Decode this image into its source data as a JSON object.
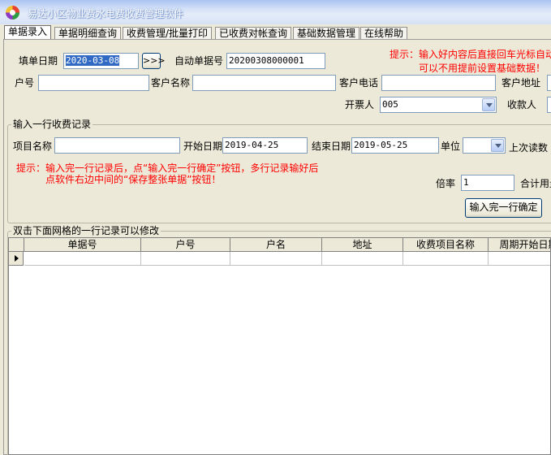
{
  "window": {
    "title": "易达小区物业费水电费收费管理软件"
  },
  "tabs": [
    {
      "label": "单据录入"
    },
    {
      "label": "单据明细查询"
    },
    {
      "label": "收费管理/批量打印"
    },
    {
      "label": "已收费对帐查询"
    },
    {
      "label": "基础数据管理"
    },
    {
      "label": "在线帮助"
    }
  ],
  "header_form": {
    "date_label": "填单日期",
    "date_value": "2020-03-08",
    "next_button": ">>>",
    "auto_no_label": "自动单据号",
    "auto_no_value": "20200308000001",
    "hint_line1": "提示：输入好内容后直接回车光标自动",
    "hint_line2": "可以不用提前设置基础数据！",
    "household_label": "户号",
    "household_value": "",
    "customer_name_label": "客户名称",
    "customer_name_value": "",
    "customer_phone_label": "客户电话",
    "customer_phone_value": "",
    "customer_address_label": "客户地址",
    "drawer_label": "开票人",
    "drawer_value": "005",
    "payee_label": "收款人"
  },
  "record_group": {
    "title": "输入一行收费记录",
    "item_label": "项目名称",
    "item_value": "",
    "start_label": "开始日期",
    "start_value": "2019-04-25",
    "end_label": "结束日期",
    "end_value": "2019-05-25",
    "unit_label": "单位",
    "unit_value": "",
    "last_reading_label": "上次读数",
    "hint_line1": "提示：输入完一行记录后，点“输入完一行确定”按钮，多行记录输好后",
    "hint_line2": "点软件右边中间的“保存整张单据”按钮！",
    "rate_label": "倍率",
    "rate_value": "1",
    "total_label": "合计用量",
    "confirm_button": "输入完一行确定"
  },
  "grid_group": {
    "title": "双击下面网格的一行记录可以修改",
    "columns": [
      "单据号",
      "户号",
      "户名",
      "地址",
      "收费项目名称",
      "周期开始日期"
    ]
  }
}
